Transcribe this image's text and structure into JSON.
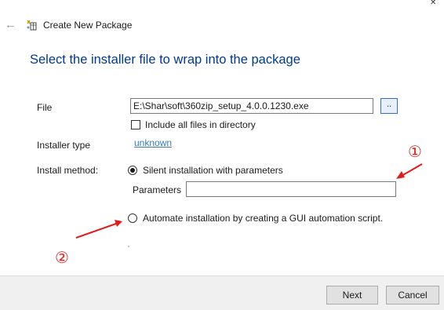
{
  "window": {
    "title": "Create New Package"
  },
  "heading": "Select the installer file to wrap into the package",
  "file": {
    "label": "File",
    "value": "E:\\Shar\\soft\\360zip_setup_4.0.0.1230.exe",
    "browse_label": "..",
    "include_all_label": "Include all files in directory",
    "include_all_checked": false
  },
  "installer_type": {
    "label": "Installer type",
    "value": "unknown"
  },
  "install_method": {
    "label": "Install method:",
    "options": [
      {
        "label": "Silent installation with parameters",
        "selected": true
      },
      {
        "label": "Automate installation by creating a GUI automation script.",
        "selected": false
      }
    ],
    "parameters_label": "Parameters",
    "parameters_value": ""
  },
  "footer": {
    "next_label": "Next",
    "cancel_label": "Cancel"
  },
  "annotations": {
    "marker_1": "①",
    "marker_2": "②",
    "color": "#e31a1a"
  },
  "colors": {
    "heading": "#003a8c",
    "link": "#3a7abf",
    "footer_bg": "#f0f0f0"
  }
}
